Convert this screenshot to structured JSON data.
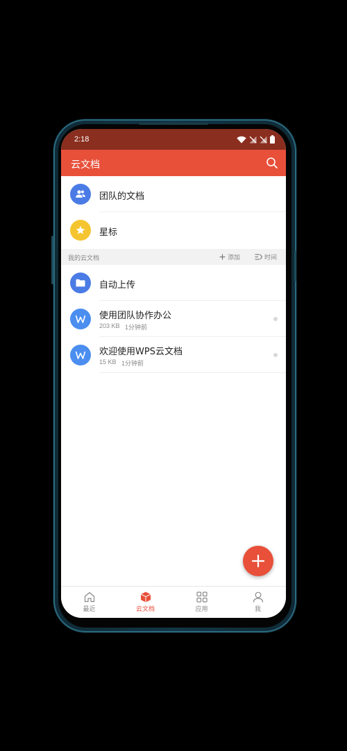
{
  "status_bar": {
    "time": "2:18"
  },
  "app_bar": {
    "title": "云文档"
  },
  "quick_items": [
    {
      "label": "团队的文档",
      "icon": "team-icon",
      "color": "#4b7be5"
    },
    {
      "label": "星标",
      "icon": "star-icon",
      "color": "#f5c531"
    }
  ],
  "section": {
    "title": "我的云文档",
    "add_label": "添加",
    "sort_label": "时间"
  },
  "files": [
    {
      "name": "自动上传",
      "type": "folder",
      "color": "#4b7be5"
    },
    {
      "name": "使用团队协作办公",
      "size": "203 KB",
      "time": "1分钟前",
      "type": "doc",
      "color": "#4b8ef0"
    },
    {
      "name": "欢迎使用WPS云文档",
      "size": "15 KB",
      "time": "1分钟前",
      "type": "doc",
      "color": "#4b8ef0"
    }
  ],
  "bottom_nav": [
    {
      "label": "最近",
      "icon": "home-icon",
      "active": false
    },
    {
      "label": "云文档",
      "icon": "cloud-box-icon",
      "active": true
    },
    {
      "label": "应用",
      "icon": "grid-icon",
      "active": false
    },
    {
      "label": "我",
      "icon": "person-icon",
      "active": false
    }
  ],
  "colors": {
    "accent": "#e8503a",
    "status_bar": "#8a2e1f",
    "inactive": "#888888"
  }
}
